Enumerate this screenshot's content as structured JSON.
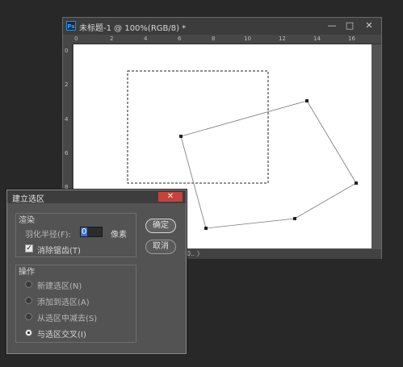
{
  "ps_window": {
    "app_icon": "Ps",
    "title": "未标题-1 @ 100%(RGB/8) *",
    "controls": {
      "minimize": "—",
      "restore": "□",
      "close": "✕"
    },
    "status_text": "0..  〉"
  },
  "ruler": {
    "h_ticks": [
      "0",
      "2",
      "4",
      "6",
      "8",
      "10",
      "12",
      "14",
      "16"
    ],
    "v_ticks": [
      "0",
      "2",
      "4",
      "6",
      "8"
    ]
  },
  "canvas": {
    "selection": "rectangular marquee (dashed)",
    "polygon_path": "lasso polygon with 6 anchor points"
  },
  "dialog": {
    "title": "建立选区",
    "close_label": "✕",
    "render_group": {
      "label": "渲染",
      "feather_label": "羽化半径(F):",
      "feather_value": "0",
      "feather_unit": "像素",
      "antialias_label": "消除锯齿(T)",
      "antialias_checked": true
    },
    "operation_group": {
      "label": "操作",
      "options": [
        {
          "label": "新建选区(N)",
          "selected": false
        },
        {
          "label": "添加到选区(A)",
          "selected": false
        },
        {
          "label": "从选区中减去(S)",
          "selected": false
        },
        {
          "label": "与选区交叉(I)",
          "selected": true
        }
      ]
    },
    "ok_label": "确定",
    "cancel_label": "取消"
  }
}
